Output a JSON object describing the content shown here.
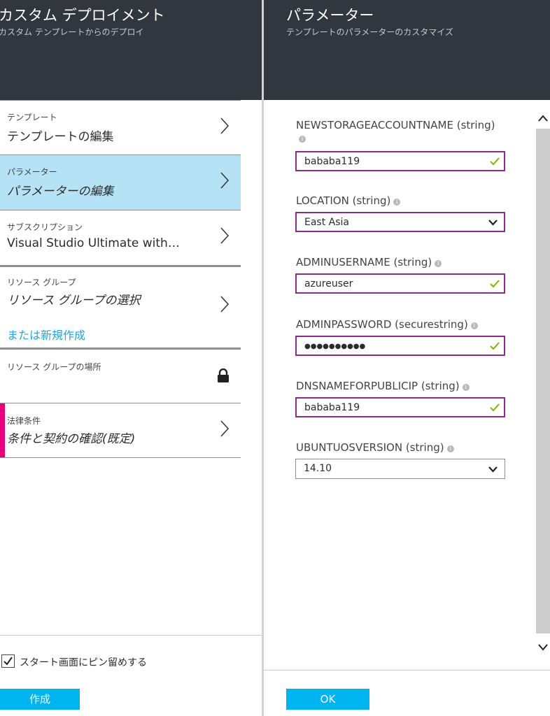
{
  "left_blade": {
    "title": "カスタム デプロイメント",
    "subtitle": "カスタム テンプレートからのデプロイ",
    "items": [
      {
        "label": "テンプレート",
        "value": "テンプレートの編集"
      },
      {
        "label": "パラメーター",
        "value": "パラメーターの編集"
      },
      {
        "label": "サブスクリプション",
        "value": "Visual Studio Ultimate with…"
      },
      {
        "label": "リソース グループ",
        "value": "リソース グループの選択",
        "link": "または新規作成"
      },
      {
        "label": "リソース グループの場所"
      },
      {
        "label": "法律条件",
        "value": "条件と契約の確認(既定)"
      }
    ],
    "pin_label": "スタート画面にピン留めする",
    "pin_checked": true,
    "create_label": "作成"
  },
  "right_blade": {
    "title": "パラメーター",
    "subtitle": "テンプレートのパラメーターのカスタマイズ",
    "params": [
      {
        "label": "NEWSTORAGEACCOUNTNAME (string)",
        "value": "bababa119"
      },
      {
        "label": "LOCATION (string)",
        "value": "East Asia"
      },
      {
        "label": "ADMINUSERNAME (string)",
        "value": "azureuser"
      },
      {
        "label": "ADMINPASSWORD (securestring)",
        "value": "●●●●●●●●●●"
      },
      {
        "label": "DNSNAMEFORPUBLICIP (string)",
        "value": "bababa119"
      },
      {
        "label": "UBUNTUOSVERSION (string)",
        "value": "14.10"
      }
    ],
    "ok_label": "OK"
  },
  "colors": {
    "header_bg": "#32363f",
    "selected_bg": "#b5e3f5",
    "accent_pink": "#e8007a",
    "valid_border": "#8a2d8f",
    "check_green": "#7ab800",
    "button_blue": "#00b4f0",
    "link_blue": "#23a5e0"
  }
}
